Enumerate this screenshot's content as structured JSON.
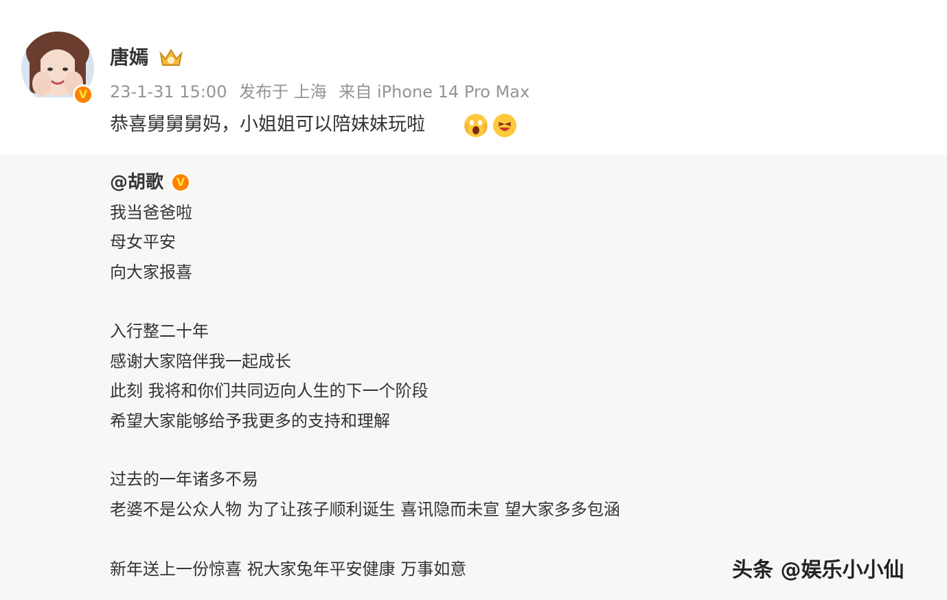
{
  "post": {
    "username": "唐嫣",
    "meta": {
      "date": "23-1-31 15:00",
      "published_in": "发布于 上海",
      "source": "来自 iPhone 14 Pro Max"
    },
    "text": "恭喜舅舅舅妈，小姐姐可以陪妹妹玩啦",
    "emojis": [
      "shock-emoji",
      "laugh-emoji"
    ]
  },
  "repost": {
    "mention": "@胡歌",
    "lines": [
      "我当爸爸啦",
      "母女平安",
      "向大家报喜",
      "入行整二十年",
      "感谢大家陪伴我一起成长",
      "此刻 我将和你们共同迈向人生的下一个阶段",
      "希望大家能够给予我更多的支持和理解",
      "过去的一年诸多不易",
      "老婆不是公众人物 为了让孩子顺利诞生 喜讯隐而未宣 望大家多多包涵",
      "新年送上一份惊喜 祝大家兔年平安健康 万事如意"
    ]
  },
  "watermark": "头条 @娱乐小小仙",
  "colors": {
    "verify_orange": "#ff8200",
    "meta_gray": "#939393",
    "text_dark": "#333333"
  }
}
